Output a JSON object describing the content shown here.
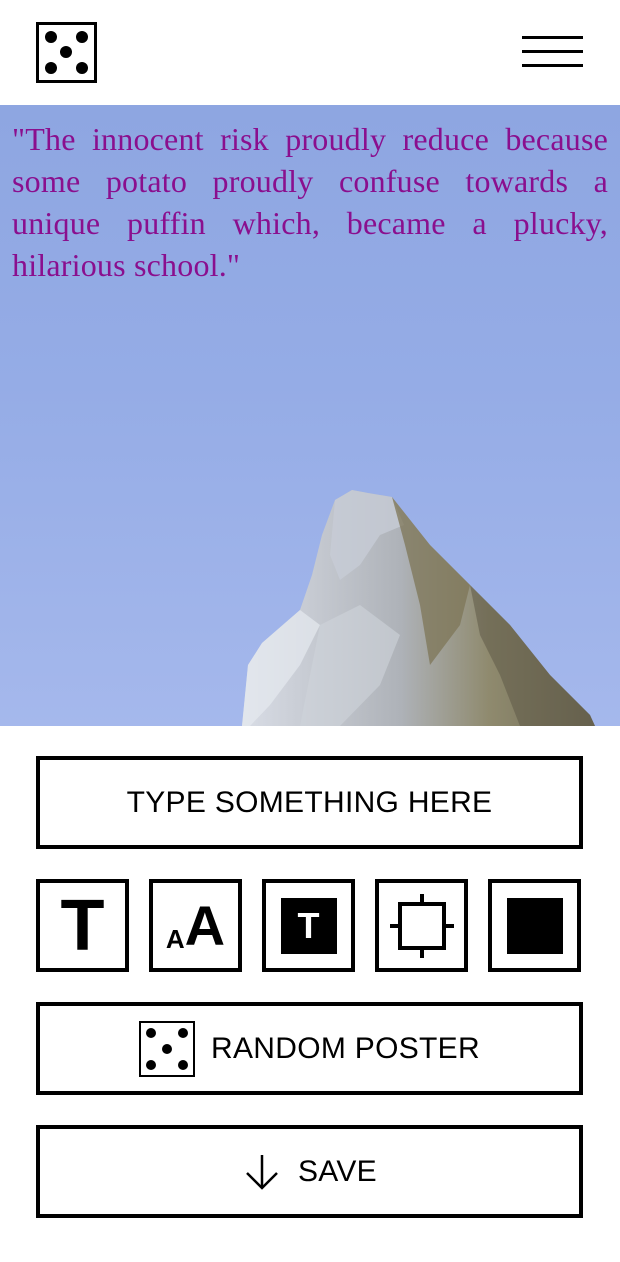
{
  "header": {
    "logo_icon": "dice-five-icon",
    "menu_icon": "hamburger-menu-icon"
  },
  "poster": {
    "quote": "\"The innocent risk proudly reduce because some potato proudly confuse towards a unique puffin which, became a plucky, hilarious school.\"",
    "quote_color": "#8a0f8e",
    "sky_color": "#95ace6"
  },
  "controls": {
    "text_input_label": "TYPE SOMETHING HERE",
    "tools": [
      {
        "icon": "bold-text-icon",
        "glyph": "T"
      },
      {
        "icon": "font-size-icon",
        "glyph_small": "A",
        "glyph_large": "A"
      },
      {
        "icon": "text-background-icon",
        "glyph": "T"
      },
      {
        "icon": "crop-frame-icon"
      },
      {
        "icon": "fill-square-icon"
      }
    ],
    "random_label": "RANDOM POSTER",
    "random_icon": "dice-five-icon",
    "save_label": "SAVE",
    "save_icon": "arrow-down-icon"
  }
}
